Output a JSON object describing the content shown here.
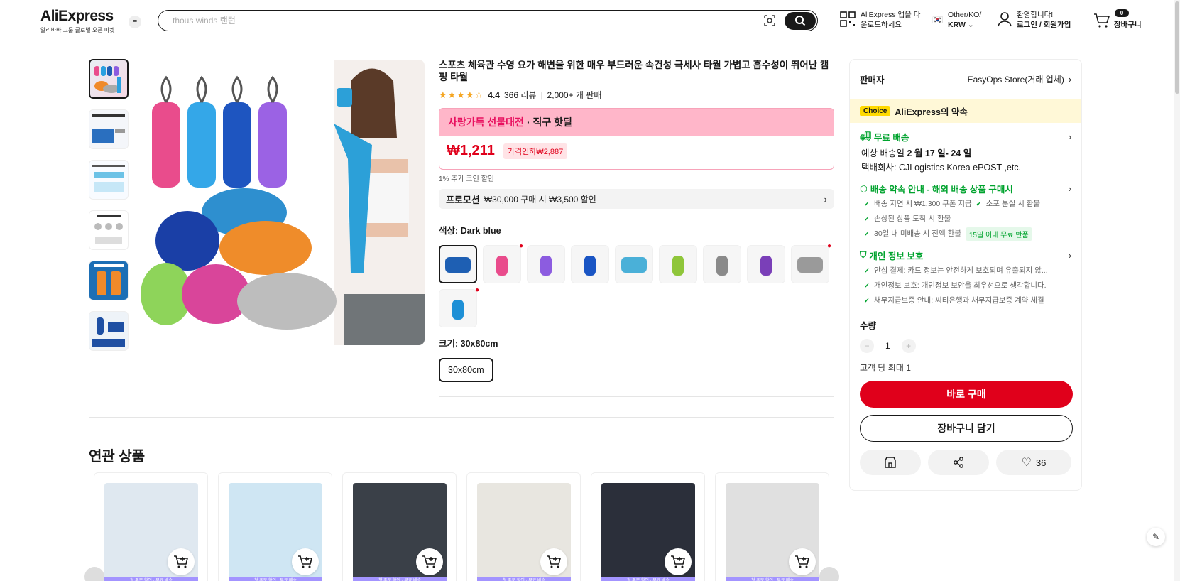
{
  "header": {
    "logo": "AliExpress",
    "logo_sub": "알리바바 그룹 글로벌 오픈 마켓",
    "search_placeholder": "thous winds 랜턴",
    "app_line1": "AliExpress 앱을 다",
    "app_line2": "운로드하세요",
    "region_line1": "Other/KO/",
    "region_line2": "KRW",
    "account_line1": "환영합니다!",
    "account_line2": "로그인 / 회원가입",
    "cart_count": "0",
    "cart_label": "장바구니"
  },
  "product": {
    "title": "스포츠 체육관 수영 요가 해변을 위한 매우 부드러운 속건성 극세사 타월 가볍고 흡수성이 뛰어난 캠핑 타월",
    "rating": "4.4",
    "reviews": "366 리뷰",
    "sold": "2,000+ 개 판매",
    "deal_left": "사랑가득 선물대전",
    "deal_right": "· 직구 핫딜",
    "price": "₩1,211",
    "price_note": "가격인하₩2,887",
    "coin_note": "1% 추가 코인 할인",
    "promo_label": "프로모션",
    "promo_text": "₩30,000 구매 시 ₩3,500 할인",
    "color_label": "색상: Dark blue",
    "size_label": "크기: 30x80cm",
    "size_value": "30x80cm",
    "swatches": [
      {
        "color": "#1e5fb3",
        "selected": true,
        "fire": false
      },
      {
        "color": "#e94c8c",
        "selected": false,
        "fire": true
      },
      {
        "color": "#8c5ce0",
        "selected": false,
        "fire": false
      },
      {
        "color": "#1a55c4",
        "selected": false,
        "fire": false
      },
      {
        "color": "#4ab0d8",
        "selected": false,
        "fire": false
      },
      {
        "color": "#8fc63a",
        "selected": false,
        "fire": false
      },
      {
        "color": "#8a8a8a",
        "selected": false,
        "fire": false
      },
      {
        "color": "#7a3fb8",
        "selected": false,
        "fire": false
      },
      {
        "color": "#9a9a9a",
        "selected": false,
        "fire": true
      },
      {
        "color": "#1e90d6",
        "selected": false,
        "fire": true
      }
    ]
  },
  "panel": {
    "seller_label": "판매자",
    "seller_name": "EasyOps Store(거래 업체)",
    "choice_badge": "Choice",
    "choice_text": "AliExpress의 약속",
    "shipping_title": "무료 배송",
    "shipping_date_prefix": "예상 배송일 ",
    "shipping_date": "2 월 17 일- 24 일",
    "carrier": "택배회사:  CJLogistics   Korea ePOST ,etc.",
    "guarantee_title": "배송 약속 안내 - 해외 배송 상품 구매시",
    "guarantee_items": [
      "배송 지연 시 ₩1,300 쿠폰 지급",
      "소포 분실 시 환불",
      "손상된 상품 도착 시 환불",
      "30일 내 미배송 시 전액 환불"
    ],
    "return_tag": "15일 이내 무료 반품",
    "privacy_title": "개인 정보 보호",
    "privacy_items": [
      "안심 결제: 카드 정보는 안전하게 보호되며 유출되지 않...",
      "개인정보 보호: 개인정보 보안을 최우선으로 생각합니다.",
      "채무지급보증 안내: 씨티은행과 채무지급보증 계약 체결"
    ],
    "qty_label": "수량",
    "qty_value": "1",
    "max_label": "고객 당 최대 1",
    "buy_label": "바로 구매",
    "cart_label": "장바구니 담기",
    "wish_count": "36"
  },
  "related": {
    "title": "연관 상품",
    "strip_text": "첫 주문 할인 · 무료 배송",
    "items": [
      {
        "bg": "#dfe8f0"
      },
      {
        "bg": "#cfe6f3"
      },
      {
        "bg": "#3a4048"
      },
      {
        "bg": "#e8e6e0"
      },
      {
        "bg": "#2b2f3a"
      },
      {
        "bg": "#e0e0e0"
      }
    ]
  }
}
